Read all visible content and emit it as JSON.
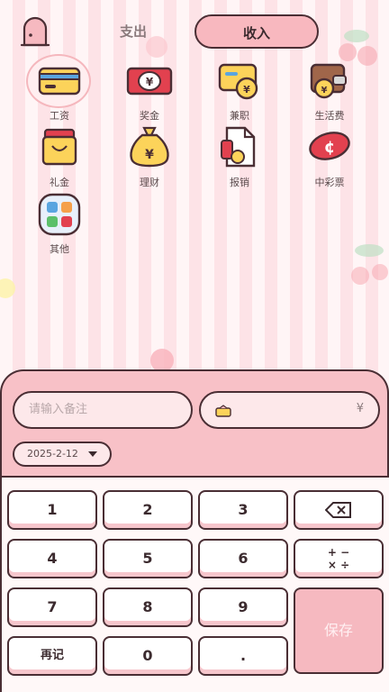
{
  "tabs": {
    "expense": "支出",
    "income": "收入",
    "active": "income"
  },
  "categories": [
    {
      "label": "工资",
      "icon": "salary-card-icon",
      "selected": true
    },
    {
      "label": "奖金",
      "icon": "bonus-banknote-icon",
      "selected": false
    },
    {
      "label": "兼职",
      "icon": "part-time-card-icon",
      "selected": false
    },
    {
      "label": "生活费",
      "icon": "wallet-icon",
      "selected": false
    },
    {
      "label": "礼金",
      "icon": "gift-box-icon",
      "selected": false
    },
    {
      "label": "理财",
      "icon": "money-bag-icon",
      "selected": false
    },
    {
      "label": "报销",
      "icon": "receipt-icon",
      "selected": false
    },
    {
      "label": "中彩票",
      "icon": "lottery-ticket-icon",
      "selected": false
    },
    {
      "label": "其他",
      "icon": "other-grid-icon",
      "selected": false
    }
  ],
  "entry": {
    "note_placeholder": "请输入备注",
    "amount_currency": "¥",
    "date": "2025-2-12"
  },
  "keypad": {
    "k1": "1",
    "k2": "2",
    "k3": "3",
    "k4": "4",
    "k5": "5",
    "k6": "6",
    "k7": "7",
    "k8": "8",
    "k9": "9",
    "k0": "0",
    "dot": ".",
    "again": "再记",
    "save": "保存",
    "ops": "+ −\n× ÷"
  },
  "colors": {
    "accent": "#f8b8bf",
    "outline": "#4a2e34",
    "background": "#fff5f6"
  }
}
